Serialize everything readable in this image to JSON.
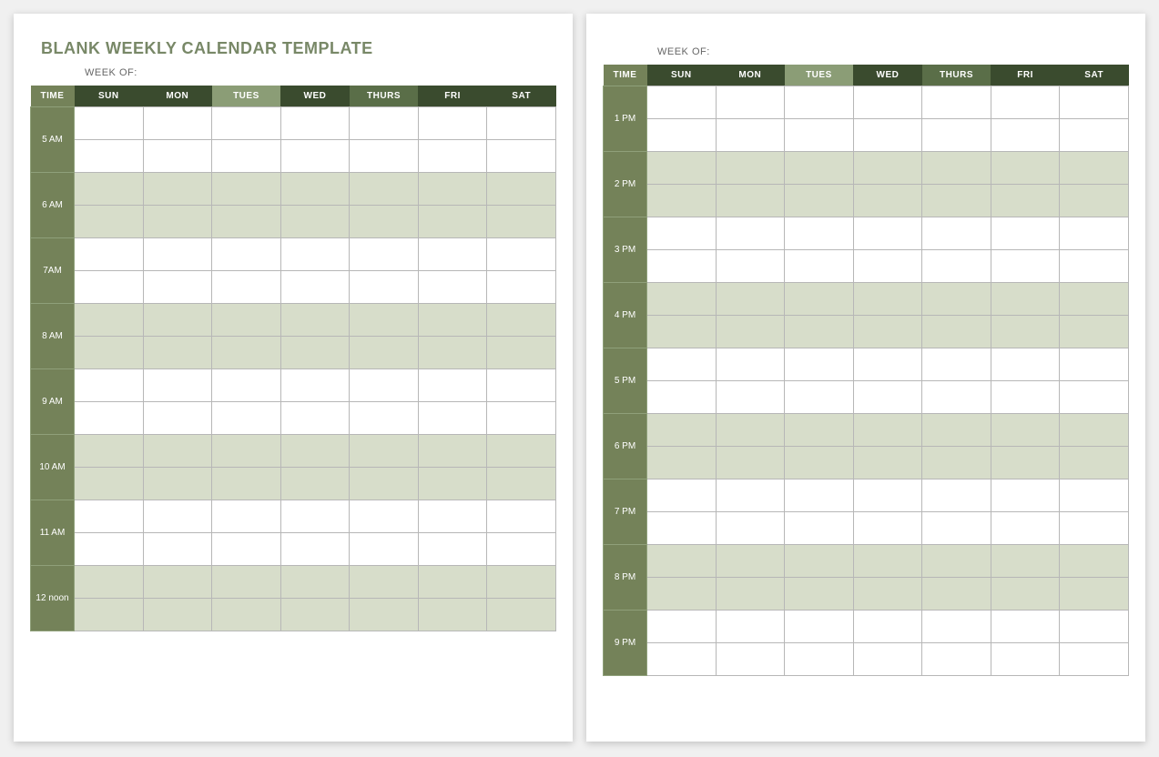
{
  "title": "BLANK WEEKLY CALENDAR TEMPLATE",
  "week_of_label": "WEEK OF:",
  "headers": {
    "time": "TIME",
    "days": [
      "SUN",
      "MON",
      "TUES",
      "WED",
      "THURS",
      "FRI",
      "SAT"
    ]
  },
  "day_shades": [
    "day-dark",
    "day-dark",
    "day-light",
    "day-dark",
    "day-med",
    "day-dark",
    "day-dark"
  ],
  "page1_times": [
    "5 AM",
    "6 AM",
    "7AM",
    "8 AM",
    "9 AM",
    "10 AM",
    "11 AM",
    "12 noon"
  ],
  "page2_times": [
    "1 PM",
    "2 PM",
    "3 PM",
    "4 PM",
    "5 PM",
    "6 PM",
    "7 PM",
    "8 PM",
    "9 PM"
  ]
}
